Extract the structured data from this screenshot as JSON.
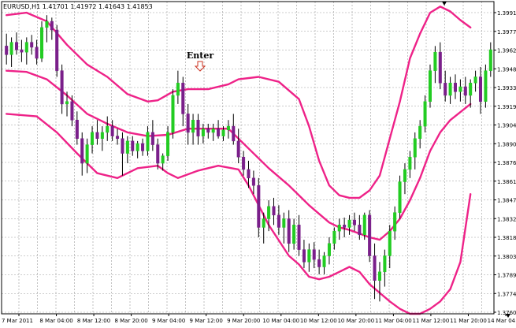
{
  "chart_title": "EURUSD,H1  1.41701 1.41972 1.41643 1.41853",
  "annotation": {
    "label": "Enter"
  },
  "colors": {
    "background": "#ffffff",
    "grid": "#9a9a9a",
    "bull": "#22cc22",
    "bear": "#7a1f8a",
    "band": "#ee2288",
    "text": "#000000",
    "arrow": "#cc3322"
  },
  "chart_data": {
    "type": "candlestick",
    "symbol": "EURUSD",
    "timeframe": "H1",
    "ylim": [
      1.3748,
      1.4001
    ],
    "y_ticks": [
      "1.39910",
      "1.39770",
      "1.39625",
      "1.39480",
      "1.39335",
      "1.39190",
      "1.39045",
      "1.38905",
      "1.38760",
      "1.38615",
      "1.38470",
      "1.38325",
      "1.38180",
      "1.38035",
      "1.37890",
      "1.37745",
      "1.37600"
    ],
    "x_ticks": [
      "7 Mar 2011",
      "8 Mar 04:00",
      "8 Mar 12:00",
      "8 Mar 20:00",
      "9 Mar 04:00",
      "9 Mar 12:00",
      "9 Mar 20:00",
      "10 Mar 04:00",
      "10 Mar 12:00",
      "10 Mar 20:00",
      "11 Mar 04:00",
      "11 Mar 12:00",
      "11 Mar 20:00",
      "14 Mar 04:00"
    ],
    "candles": [
      {
        "o": 1.3965,
        "h": 1.3975,
        "l": 1.395,
        "c": 1.3958
      },
      {
        "o": 1.3958,
        "h": 1.3972,
        "l": 1.3948,
        "c": 1.3968
      },
      {
        "o": 1.3968,
        "h": 1.3976,
        "l": 1.3958,
        "c": 1.3962
      },
      {
        "o": 1.3962,
        "h": 1.397,
        "l": 1.3952,
        "c": 1.396
      },
      {
        "o": 1.396,
        "h": 1.3972,
        "l": 1.395,
        "c": 1.3968
      },
      {
        "o": 1.3968,
        "h": 1.3974,
        "l": 1.3958,
        "c": 1.3964
      },
      {
        "o": 1.3964,
        "h": 1.397,
        "l": 1.395,
        "c": 1.3955
      },
      {
        "o": 1.3955,
        "h": 1.3985,
        "l": 1.3952,
        "c": 1.398
      },
      {
        "o": 1.398,
        "h": 1.399,
        "l": 1.3968,
        "c": 1.3985
      },
      {
        "o": 1.3985,
        "h": 1.3988,
        "l": 1.397,
        "c": 1.3978
      },
      {
        "o": 1.3978,
        "h": 1.3982,
        "l": 1.394,
        "c": 1.3945
      },
      {
        "o": 1.3945,
        "h": 1.395,
        "l": 1.391,
        "c": 1.3918
      },
      {
        "o": 1.3918,
        "h": 1.3928,
        "l": 1.3908,
        "c": 1.392
      },
      {
        "o": 1.392,
        "h": 1.3925,
        "l": 1.39,
        "c": 1.3905
      },
      {
        "o": 1.3905,
        "h": 1.3912,
        "l": 1.3885,
        "c": 1.389
      },
      {
        "o": 1.389,
        "h": 1.3895,
        "l": 1.386,
        "c": 1.387
      },
      {
        "o": 1.387,
        "h": 1.389,
        "l": 1.3862,
        "c": 1.3885
      },
      {
        "o": 1.3885,
        "h": 1.39,
        "l": 1.3878,
        "c": 1.3895
      },
      {
        "o": 1.3895,
        "h": 1.3905,
        "l": 1.3885,
        "c": 1.389
      },
      {
        "o": 1.389,
        "h": 1.39,
        "l": 1.388,
        "c": 1.3895
      },
      {
        "o": 1.3895,
        "h": 1.3908,
        "l": 1.3888,
        "c": 1.39
      },
      {
        "o": 1.39,
        "h": 1.3905,
        "l": 1.3888,
        "c": 1.3892
      },
      {
        "o": 1.3892,
        "h": 1.3898,
        "l": 1.3885,
        "c": 1.389
      },
      {
        "o": 1.389,
        "h": 1.3895,
        "l": 1.386,
        "c": 1.3878
      },
      {
        "o": 1.3878,
        "h": 1.3892,
        "l": 1.387,
        "c": 1.3888
      },
      {
        "o": 1.3888,
        "h": 1.3892,
        "l": 1.3876,
        "c": 1.388
      },
      {
        "o": 1.388,
        "h": 1.3888,
        "l": 1.3874,
        "c": 1.3886
      },
      {
        "o": 1.3886,
        "h": 1.389,
        "l": 1.3876,
        "c": 1.388
      },
      {
        "o": 1.388,
        "h": 1.39,
        "l": 1.3876,
        "c": 1.3895
      },
      {
        "o": 1.3895,
        "h": 1.3905,
        "l": 1.388,
        "c": 1.3885
      },
      {
        "o": 1.3885,
        "h": 1.389,
        "l": 1.3865,
        "c": 1.387
      },
      {
        "o": 1.387,
        "h": 1.3878,
        "l": 1.3864,
        "c": 1.3876
      },
      {
        "o": 1.3876,
        "h": 1.39,
        "l": 1.3872,
        "c": 1.3895
      },
      {
        "o": 1.3895,
        "h": 1.393,
        "l": 1.389,
        "c": 1.3925
      },
      {
        "o": 1.3925,
        "h": 1.3945,
        "l": 1.3918,
        "c": 1.3935
      },
      {
        "o": 1.3935,
        "h": 1.394,
        "l": 1.39,
        "c": 1.391
      },
      {
        "o": 1.391,
        "h": 1.3918,
        "l": 1.3885,
        "c": 1.3895
      },
      {
        "o": 1.3895,
        "h": 1.391,
        "l": 1.3885,
        "c": 1.3905
      },
      {
        "o": 1.3905,
        "h": 1.391,
        "l": 1.3885,
        "c": 1.3892
      },
      {
        "o": 1.3892,
        "h": 1.3902,
        "l": 1.3886,
        "c": 1.3898
      },
      {
        "o": 1.3898,
        "h": 1.3902,
        "l": 1.389,
        "c": 1.3895
      },
      {
        "o": 1.3895,
        "h": 1.3902,
        "l": 1.3888,
        "c": 1.3898
      },
      {
        "o": 1.3898,
        "h": 1.3905,
        "l": 1.389,
        "c": 1.3892
      },
      {
        "o": 1.3892,
        "h": 1.39,
        "l": 1.3888,
        "c": 1.3897
      },
      {
        "o": 1.3897,
        "h": 1.3905,
        "l": 1.389,
        "c": 1.39
      },
      {
        "o": 1.39,
        "h": 1.391,
        "l": 1.3885,
        "c": 1.3888
      },
      {
        "o": 1.3888,
        "h": 1.3898,
        "l": 1.387,
        "c": 1.3875
      },
      {
        "o": 1.3875,
        "h": 1.388,
        "l": 1.386,
        "c": 1.3865
      },
      {
        "o": 1.3865,
        "h": 1.3872,
        "l": 1.385,
        "c": 1.3858
      },
      {
        "o": 1.3858,
        "h": 1.3864,
        "l": 1.3845,
        "c": 1.3852
      },
      {
        "o": 1.3852,
        "h": 1.3858,
        "l": 1.381,
        "c": 1.3818
      },
      {
        "o": 1.3818,
        "h": 1.383,
        "l": 1.3805,
        "c": 1.3825
      },
      {
        "o": 1.3825,
        "h": 1.384,
        "l": 1.3815,
        "c": 1.3835
      },
      {
        "o": 1.3835,
        "h": 1.3842,
        "l": 1.382,
        "c": 1.3828
      },
      {
        "o": 1.3828,
        "h": 1.3836,
        "l": 1.3812,
        "c": 1.3818
      },
      {
        "o": 1.3818,
        "h": 1.383,
        "l": 1.3805,
        "c": 1.3825
      },
      {
        "o": 1.3825,
        "h": 1.3832,
        "l": 1.3798,
        "c": 1.3805
      },
      {
        "o": 1.3805,
        "h": 1.3825,
        "l": 1.38,
        "c": 1.382
      },
      {
        "o": 1.382,
        "h": 1.3828,
        "l": 1.3795,
        "c": 1.38
      },
      {
        "o": 1.38,
        "h": 1.3808,
        "l": 1.3785,
        "c": 1.379
      },
      {
        "o": 1.379,
        "h": 1.3805,
        "l": 1.3782,
        "c": 1.38
      },
      {
        "o": 1.38,
        "h": 1.3806,
        "l": 1.3785,
        "c": 1.3792
      },
      {
        "o": 1.3792,
        "h": 1.38,
        "l": 1.378,
        "c": 1.3786
      },
      {
        "o": 1.3786,
        "h": 1.3798,
        "l": 1.378,
        "c": 1.3795
      },
      {
        "o": 1.3795,
        "h": 1.381,
        "l": 1.3788,
        "c": 1.3805
      },
      {
        "o": 1.3805,
        "h": 1.3818,
        "l": 1.38,
        "c": 1.3815
      },
      {
        "o": 1.3815,
        "h": 1.3825,
        "l": 1.3808,
        "c": 1.382
      },
      {
        "o": 1.382,
        "h": 1.3826,
        "l": 1.381,
        "c": 1.3818
      },
      {
        "o": 1.3818,
        "h": 1.3828,
        "l": 1.3812,
        "c": 1.3824
      },
      {
        "o": 1.3824,
        "h": 1.383,
        "l": 1.3815,
        "c": 1.382
      },
      {
        "o": 1.382,
        "h": 1.3828,
        "l": 1.3808,
        "c": 1.3812
      },
      {
        "o": 1.3812,
        "h": 1.383,
        "l": 1.3808,
        "c": 1.3828
      },
      {
        "o": 1.3828,
        "h": 1.3832,
        "l": 1.379,
        "c": 1.3795
      },
      {
        "o": 1.3795,
        "h": 1.3805,
        "l": 1.376,
        "c": 1.3775
      },
      {
        "o": 1.3775,
        "h": 1.379,
        "l": 1.3758,
        "c": 1.3782
      },
      {
        "o": 1.3782,
        "h": 1.38,
        "l": 1.377,
        "c": 1.3795
      },
      {
        "o": 1.3795,
        "h": 1.382,
        "l": 1.3785,
        "c": 1.3815
      },
      {
        "o": 1.3815,
        "h": 1.3835,
        "l": 1.3808,
        "c": 1.383
      },
      {
        "o": 1.383,
        "h": 1.386,
        "l": 1.3825,
        "c": 1.3855
      },
      {
        "o": 1.3855,
        "h": 1.387,
        "l": 1.3845,
        "c": 1.3865
      },
      {
        "o": 1.3865,
        "h": 1.388,
        "l": 1.3858,
        "c": 1.3875
      },
      {
        "o": 1.3875,
        "h": 1.3895,
        "l": 1.3865,
        "c": 1.389
      },
      {
        "o": 1.389,
        "h": 1.3905,
        "l": 1.3882,
        "c": 1.39
      },
      {
        "o": 1.39,
        "h": 1.3925,
        "l": 1.3895,
        "c": 1.392
      },
      {
        "o": 1.392,
        "h": 1.395,
        "l": 1.3915,
        "c": 1.3945
      },
      {
        "o": 1.3945,
        "h": 1.3965,
        "l": 1.3935,
        "c": 1.396
      },
      {
        "o": 1.396,
        "h": 1.3968,
        "l": 1.393,
        "c": 1.3935
      },
      {
        "o": 1.3935,
        "h": 1.3945,
        "l": 1.392,
        "c": 1.3925
      },
      {
        "o": 1.3925,
        "h": 1.394,
        "l": 1.3918,
        "c": 1.3935
      },
      {
        "o": 1.3935,
        "h": 1.3942,
        "l": 1.3922,
        "c": 1.3928
      },
      {
        "o": 1.3928,
        "h": 1.3938,
        "l": 1.392,
        "c": 1.3932
      },
      {
        "o": 1.3932,
        "h": 1.394,
        "l": 1.3918,
        "c": 1.3925
      },
      {
        "o": 1.3925,
        "h": 1.3938,
        "l": 1.3915,
        "c": 1.3935
      },
      {
        "o": 1.3935,
        "h": 1.3945,
        "l": 1.3928,
        "c": 1.394
      },
      {
        "o": 1.394,
        "h": 1.3948,
        "l": 1.391,
        "c": 1.392
      },
      {
        "o": 1.392,
        "h": 1.395,
        "l": 1.3915,
        "c": 1.3945
      },
      {
        "o": 1.3945,
        "h": 1.3968,
        "l": 1.394,
        "c": 1.3962
      }
    ],
    "bands": {
      "name": "Bollinger Bands",
      "upper": [
        [
          0,
          1.399
        ],
        [
          4,
          1.3992
        ],
        [
          8,
          1.3985
        ],
        [
          12,
          1.3966
        ],
        [
          16,
          1.395
        ],
        [
          20,
          1.394
        ],
        [
          24,
          1.3926
        ],
        [
          28,
          1.392
        ],
        [
          30,
          1.3921
        ],
        [
          33,
          1.3928
        ],
        [
          36,
          1.393
        ],
        [
          40,
          1.393
        ],
        [
          44,
          1.3934
        ],
        [
          46,
          1.3938
        ],
        [
          50,
          1.394
        ],
        [
          54,
          1.3936
        ],
        [
          58,
          1.3922
        ],
        [
          60,
          1.39
        ],
        [
          62,
          1.3872
        ],
        [
          64,
          1.3852
        ],
        [
          66,
          1.3844
        ],
        [
          68,
          1.3842
        ],
        [
          70,
          1.3842
        ],
        [
          72,
          1.3848
        ],
        [
          74,
          1.386
        ],
        [
          76,
          1.389
        ],
        [
          78,
          1.392
        ],
        [
          80,
          1.3955
        ],
        [
          82,
          1.3975
        ],
        [
          84,
          1.3992
        ],
        [
          86,
          1.3997
        ],
        [
          88,
          1.3993
        ],
        [
          90,
          1.3986
        ],
        [
          92,
          1.398
        ]
      ],
      "middle": [
        [
          0,
          1.3945
        ],
        [
          4,
          1.3944
        ],
        [
          8,
          1.3938
        ],
        [
          12,
          1.3925
        ],
        [
          16,
          1.391
        ],
        [
          20,
          1.3902
        ],
        [
          24,
          1.3895
        ],
        [
          28,
          1.3892
        ],
        [
          32,
          1.3893
        ],
        [
          36,
          1.3898
        ],
        [
          40,
          1.3898
        ],
        [
          44,
          1.3898
        ],
        [
          48,
          1.3882
        ],
        [
          52,
          1.3866
        ],
        [
          56,
          1.3852
        ],
        [
          60,
          1.3836
        ],
        [
          64,
          1.3822
        ],
        [
          66,
          1.3818
        ],
        [
          68,
          1.3816
        ],
        [
          70,
          1.3813
        ],
        [
          72,
          1.381
        ],
        [
          74,
          1.3808
        ],
        [
          76,
          1.3815
        ],
        [
          78,
          1.3825
        ],
        [
          80,
          1.384
        ],
        [
          82,
          1.3858
        ],
        [
          84,
          1.388
        ],
        [
          86,
          1.3895
        ],
        [
          88,
          1.3905
        ],
        [
          92,
          1.3918
        ]
      ],
      "lower": [
        [
          0,
          1.391
        ],
        [
          6,
          1.3908
        ],
        [
          10,
          1.3895
        ],
        [
          14,
          1.3878
        ],
        [
          18,
          1.3862
        ],
        [
          22,
          1.3858
        ],
        [
          26,
          1.3866
        ],
        [
          30,
          1.3868
        ],
        [
          32,
          1.3862
        ],
        [
          34,
          1.3858
        ],
        [
          38,
          1.3864
        ],
        [
          42,
          1.3868
        ],
        [
          46,
          1.3865
        ],
        [
          48,
          1.3852
        ],
        [
          52,
          1.382
        ],
        [
          56,
          1.3795
        ],
        [
          58,
          1.3788
        ],
        [
          60,
          1.3778
        ],
        [
          62,
          1.3776
        ],
        [
          64,
          1.3778
        ],
        [
          66,
          1.3782
        ],
        [
          68,
          1.3786
        ],
        [
          70,
          1.3782
        ],
        [
          72,
          1.3772
        ],
        [
          74,
          1.3765
        ],
        [
          76,
          1.3758
        ],
        [
          78,
          1.3752
        ],
        [
          80,
          1.3748
        ],
        [
          82,
          1.3748
        ],
        [
          84,
          1.3752
        ],
        [
          86,
          1.3758
        ],
        [
          88,
          1.3768
        ],
        [
          90,
          1.379
        ],
        [
          92,
          1.3845
        ]
      ]
    },
    "grid": true
  }
}
